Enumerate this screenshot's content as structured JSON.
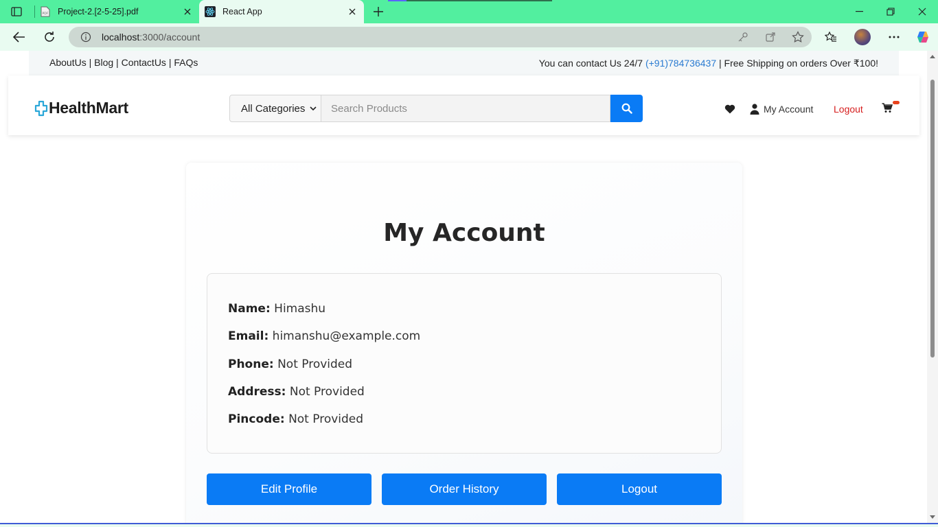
{
  "browser": {
    "tabs": [
      {
        "title": "Project-2.[2-5-25].pdf",
        "favicon": "pdf-icon",
        "active": false
      },
      {
        "title": "React App",
        "favicon": "react-icon",
        "active": true
      }
    ],
    "url_host": "localhost",
    "url_path": ":3000/account"
  },
  "topbar": {
    "links": [
      "AboutUs",
      "Blog",
      "ContactUs",
      "FAQs"
    ],
    "contact_prefix": "You can contact Us 24/7 ",
    "phone": "(+91)784736437",
    "contact_suffix": " | Free Shipping on orders Over ₹100!"
  },
  "header": {
    "logo_text": "HealthMart",
    "category": "All Categories",
    "search_placeholder": "Search Products",
    "my_account_label": "My Account",
    "logout_label": "Logout"
  },
  "account": {
    "title": "My Account",
    "fields": [
      {
        "label": "Name:",
        "value": "Himashu"
      },
      {
        "label": "Email:",
        "value": "himanshu@example.com"
      },
      {
        "label": "Phone:",
        "value": "Not Provided"
      },
      {
        "label": "Address:",
        "value": "Not Provided"
      },
      {
        "label": "Pincode:",
        "value": "Not Provided"
      }
    ],
    "buttons": {
      "edit": "Edit Profile",
      "orders": "Order History",
      "logout": "Logout"
    }
  },
  "colors": {
    "accent": "#0a7bf5",
    "logout": "#d61d1d",
    "tabbar": "#52ef9f",
    "phone": "#2a7bd1"
  }
}
